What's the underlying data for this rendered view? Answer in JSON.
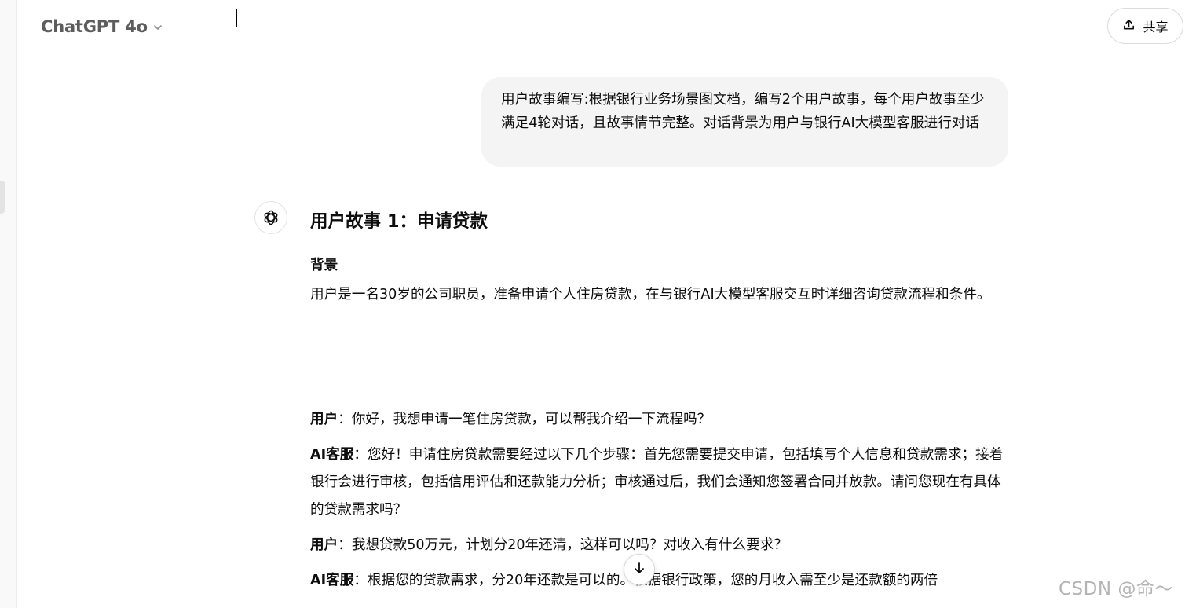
{
  "header": {
    "model_name": "ChatGPT 4o",
    "model_chevron_icon": "chevron-down-icon",
    "share_label": "共享",
    "share_icon": "upload-icon"
  },
  "user_message": {
    "text": "用户故事编写:根据银行业务场景图文档，编写2个用户故事，每个用户故事至少满足4轮对话，且故事情节完整。对话背景为用户与银行AI大模型客服进行对话"
  },
  "assistant": {
    "avatar_icon": "openai-logo-icon",
    "story_title": "用户故事 1：申请贷款",
    "background_heading": "背景",
    "background_text": "用户是一名30岁的公司职员，准备申请个人住房贷款，在与银行AI大模型客服交互时详细咨询贷款流程和条件。",
    "dialogue": [
      {
        "speaker": "用户",
        "separator": "：",
        "text": "你好，我想申请一笔住房贷款，可以帮我介绍一下流程吗？"
      },
      {
        "speaker": "AI客服",
        "separator": "：",
        "text": "您好！申请住房贷款需要经过以下几个步骤：首先您需要提交申请，包括填写个人信息和贷款需求；接着银行会进行审核，包括信用评估和还款能力分析；审核通过后，我们会通知您签署合同并放款。请问您现在有具体的贷款需求吗？"
      },
      {
        "speaker": "用户",
        "separator": "：",
        "text": "我想贷款50万元，计划分20年还清，这样可以吗？对收入有什么要求？"
      },
      {
        "speaker": "AI客服",
        "separator": "：",
        "text": "根据您的贷款需求，分20年还款是可以的。根据银行政策，您的月收入需至少是还款额的两倍"
      }
    ]
  },
  "scroll_button_icon": "arrow-down-icon",
  "watermark": "CSDN @命～"
}
